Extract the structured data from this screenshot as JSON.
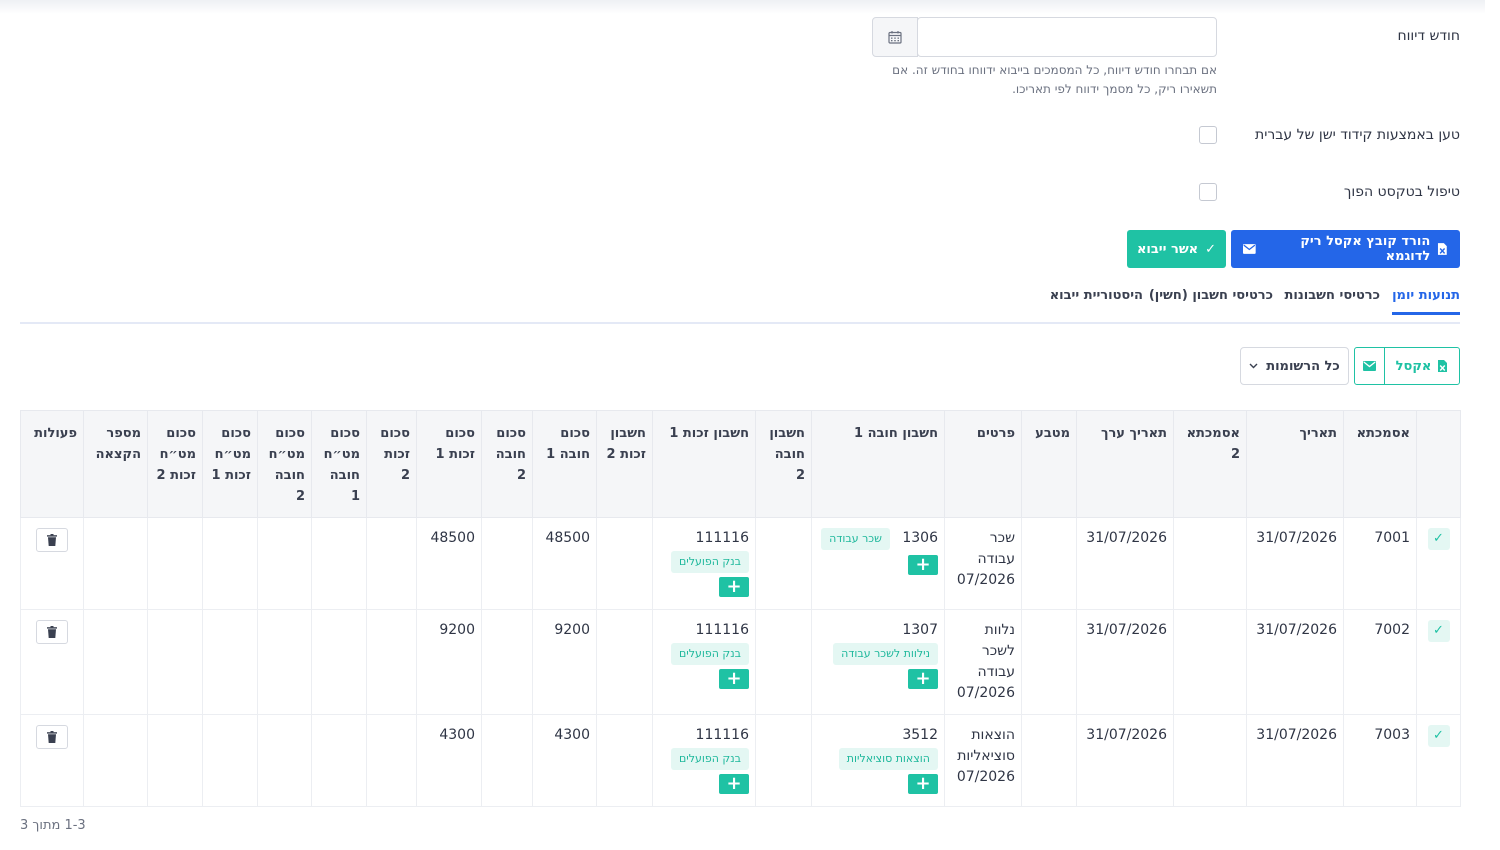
{
  "form": {
    "report_month_label": "חודש דיווח",
    "report_month_value": "",
    "report_month_help": "אם תבחרו חודש דיווח, כל המסמכים בייבוא ידווחו בחודש זה. אם תשאירו ריק, כל מסמך ידווח לפי תאריכו.",
    "legacy_encoding_label": "טען באמצעות קידוד ישן של עברית",
    "reverse_text_label": "טיפול בטקסט הפוך"
  },
  "actions": {
    "download_sample_label": "הורד קובץ אקסל ריק לדוגמא",
    "confirm_import_label": "אשר ייבוא"
  },
  "tabs": [
    "תנועות יומן",
    "כרטיסי חשבונות",
    "כרטיסי חשבון (חשין)",
    "היסטוריית ייבוא"
  ],
  "toolbar": {
    "excel_label": "אקסל",
    "records_filter_label": "כל הרשומות"
  },
  "table": {
    "columns": [
      "אסמכתא",
      "תאריך",
      "אסמכתא 2",
      "תאריך ערך",
      "מטבע",
      "פרטים",
      "חשבון חובה 1",
      "חשבון חובה 2",
      "חשבון זכות 1",
      "חשבון זכות 2",
      "סכום חובה 1",
      "סכום חובה 2",
      "סכום זכות 1",
      "סכום זכות 2",
      "סכום מט״ח חובה 1",
      "סכום מט״ח חובה 2",
      "סכום מט״ח זכות 1",
      "סכום מט״ח זכות 2",
      "מספר הקצאה",
      "פעולות"
    ],
    "rows": [
      {
        "ref": "7001",
        "date": "31/07/2026",
        "ref2": "",
        "value_date": "31/07/2026",
        "currency": "",
        "details": "שכר עבודה 07/2026",
        "debit1": "1306",
        "debit1_tag": "שכר עבודה",
        "debit2": "",
        "credit1": "111116",
        "credit1_tag": "בנק הפועלים",
        "credit2": "",
        "debit_amount1": "48500",
        "debit_amount2": "",
        "credit_amount1": "48500",
        "credit_amount2": "",
        "fx_debit1": "",
        "fx_debit2": "",
        "fx_credit1": "",
        "fx_credit2": "",
        "allocation": ""
      },
      {
        "ref": "7002",
        "date": "31/07/2026",
        "ref2": "",
        "value_date": "31/07/2026",
        "currency": "",
        "details": "נלוות לשכר עבודה 07/2026",
        "debit1": "1307",
        "debit1_tag": "נילוות לשכר עבודה",
        "debit2": "",
        "credit1": "111116",
        "credit1_tag": "בנק הפועלים",
        "credit2": "",
        "debit_amount1": "9200",
        "debit_amount2": "",
        "credit_amount1": "9200",
        "credit_amount2": "",
        "fx_debit1": "",
        "fx_debit2": "",
        "fx_credit1": "",
        "fx_credit2": "",
        "allocation": ""
      },
      {
        "ref": "7003",
        "date": "31/07/2026",
        "ref2": "",
        "value_date": "31/07/2026",
        "currency": "",
        "details": "הוצאות סוציאליות 07/2026",
        "debit1": "3512",
        "debit1_tag": "הוצאות סוציאליות",
        "debit2": "",
        "credit1": "111116",
        "credit1_tag": "בנק הפועלים",
        "credit2": "",
        "debit_amount1": "4300",
        "debit_amount2": "",
        "credit_amount1": "4300",
        "credit_amount2": "",
        "fx_debit1": "",
        "fx_debit2": "",
        "fx_credit1": "",
        "fx_credit2": "",
        "allocation": ""
      }
    ]
  },
  "pagination": {
    "label": "1-3 מתוך 3"
  },
  "colors": {
    "primary": "#2466e8",
    "success": "#1fc2a4",
    "tag_bg": "#e4f7f3"
  },
  "icons": {
    "calendar": "calendar-icon",
    "excel": "excel-file-icon",
    "mail": "envelope-icon",
    "check": "check-icon",
    "trash": "trash-icon",
    "plus": "plus-icon",
    "chevron": "chevron-down-icon"
  }
}
